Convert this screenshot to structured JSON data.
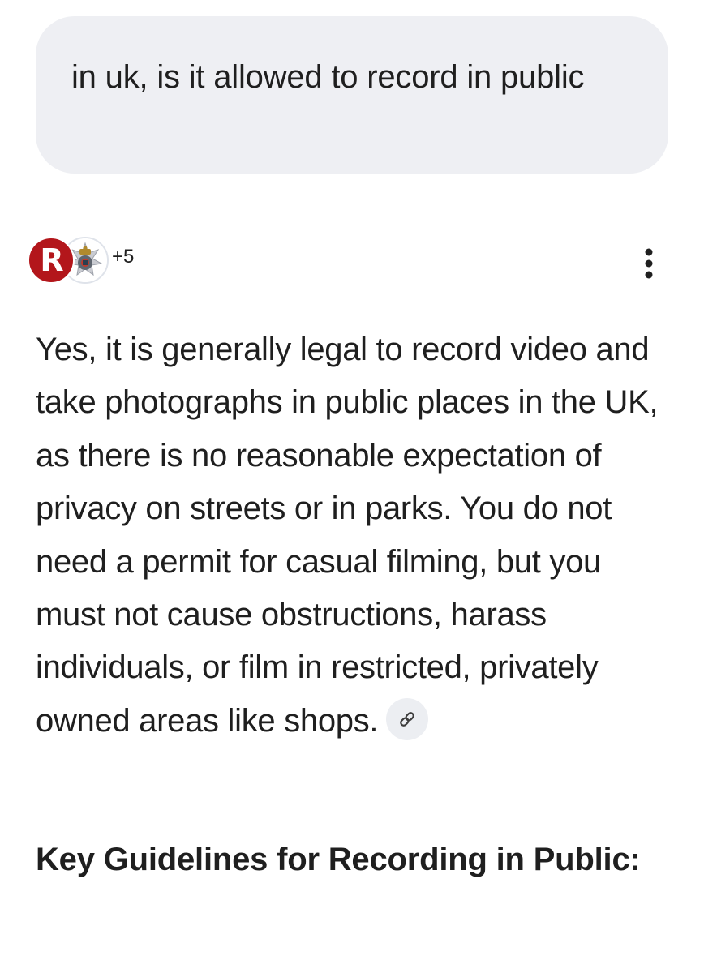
{
  "query": {
    "text": "in uk, is it allowed to record in public"
  },
  "sources": {
    "avatars": [
      {
        "letter": "R",
        "color": "#b3161b",
        "icon": "r-logo-icon"
      },
      {
        "icon": "police-crest-icon"
      }
    ],
    "more_count": "+5",
    "menu_icon": "more-vert-icon"
  },
  "answer": {
    "paragraph": "Yes, it is generally legal to record video and take photographs in public places in the UK, as there is no reasonable expectation of privacy on streets or in parks. You do not need a permit for casual filming, but you must not cause obstructions, harass individuals, or film in restricted, privately owned areas like shops.",
    "link_icon": "link-icon"
  },
  "section": {
    "heading": "Key Guidelines for Recording in Public:"
  },
  "colors": {
    "bubble_bg": "#eeeff3",
    "text": "#1f1f1f",
    "chip_bg": "#eceef2",
    "brand_red": "#b3161b"
  }
}
